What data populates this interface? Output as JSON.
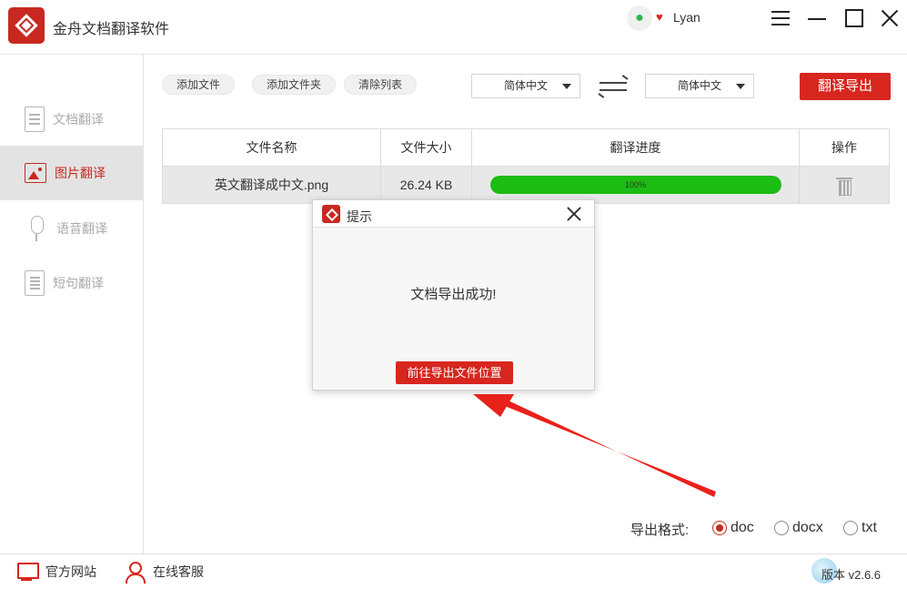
{
  "app": {
    "title": "金舟文档翻译软件",
    "username": "Lyan"
  },
  "sidebar": {
    "items": [
      {
        "label": "文档翻译"
      },
      {
        "label": "图片翻译"
      },
      {
        "label": "语音翻译"
      },
      {
        "label": "短句翻译"
      }
    ]
  },
  "toolbar": {
    "add_file": "添加文件",
    "add_folder": "添加文件夹",
    "clear_list": "清除列表",
    "source_lang": "简体中文",
    "target_lang": "简体中文",
    "export_button": "翻译导出"
  },
  "table": {
    "headers": [
      "文件名称",
      "文件大小",
      "翻译进度",
      "操作"
    ],
    "rows": [
      {
        "name": "英文翻译成中文.png",
        "size": "26.24 KB",
        "progress_label": "100%",
        "progress": 100
      }
    ]
  },
  "dialog": {
    "title": "提示",
    "message": "文档导出成功!",
    "button": "前往导出文件位置"
  },
  "export_format": {
    "label": "导出格式:",
    "options": [
      "doc",
      "docx",
      "txt"
    ],
    "selected": "doc"
  },
  "footer": {
    "website": "官方网站",
    "support": "在线客服",
    "version": "版本 v2.6.6"
  },
  "colors": {
    "accent": "#d7261e",
    "progress": "#1cbc12"
  }
}
